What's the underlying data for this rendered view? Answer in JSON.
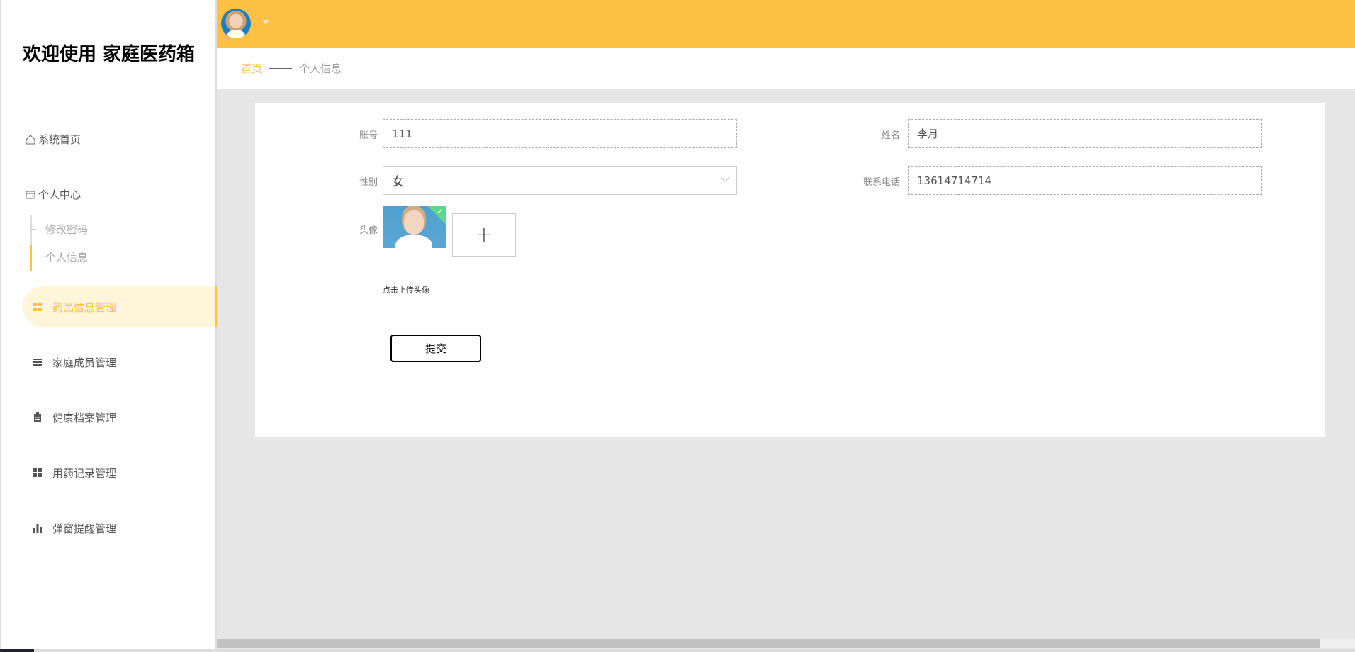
{
  "sidebar": {
    "brand": "欢迎使用 家庭医药箱",
    "home": {
      "label": "系统首页",
      "icon": "home-icon"
    },
    "personal": {
      "label": "个人中心",
      "icon": "wallet-icon",
      "children": [
        {
          "label": "修改密码"
        },
        {
          "label": "个人信息",
          "active": true
        }
      ]
    },
    "items": [
      {
        "label": "药品信息管理",
        "icon": "grid-icon",
        "active": true
      },
      {
        "label": "家庭成员管理",
        "icon": "list-icon"
      },
      {
        "label": "健康档案管理",
        "icon": "clipboard-icon"
      },
      {
        "label": "用药记录管理",
        "icon": "grid-icon"
      },
      {
        "label": "弹窗提醒管理",
        "icon": "bar-chart-icon"
      }
    ]
  },
  "breadcrumb": {
    "home": "首页",
    "current": "个人信息"
  },
  "form": {
    "account": {
      "label": "账号",
      "value": "111"
    },
    "name": {
      "label": "姓名",
      "value": "李月"
    },
    "gender": {
      "label": "性别",
      "value": "女"
    },
    "phone": {
      "label": "联系电话",
      "value": "13614714714"
    },
    "avatar": {
      "label": "头像",
      "hint": "点击上传头像",
      "add": "+"
    },
    "submit": "提交"
  },
  "colors": {
    "accent": "#ffc144",
    "active_bg": "#fff6d9"
  }
}
